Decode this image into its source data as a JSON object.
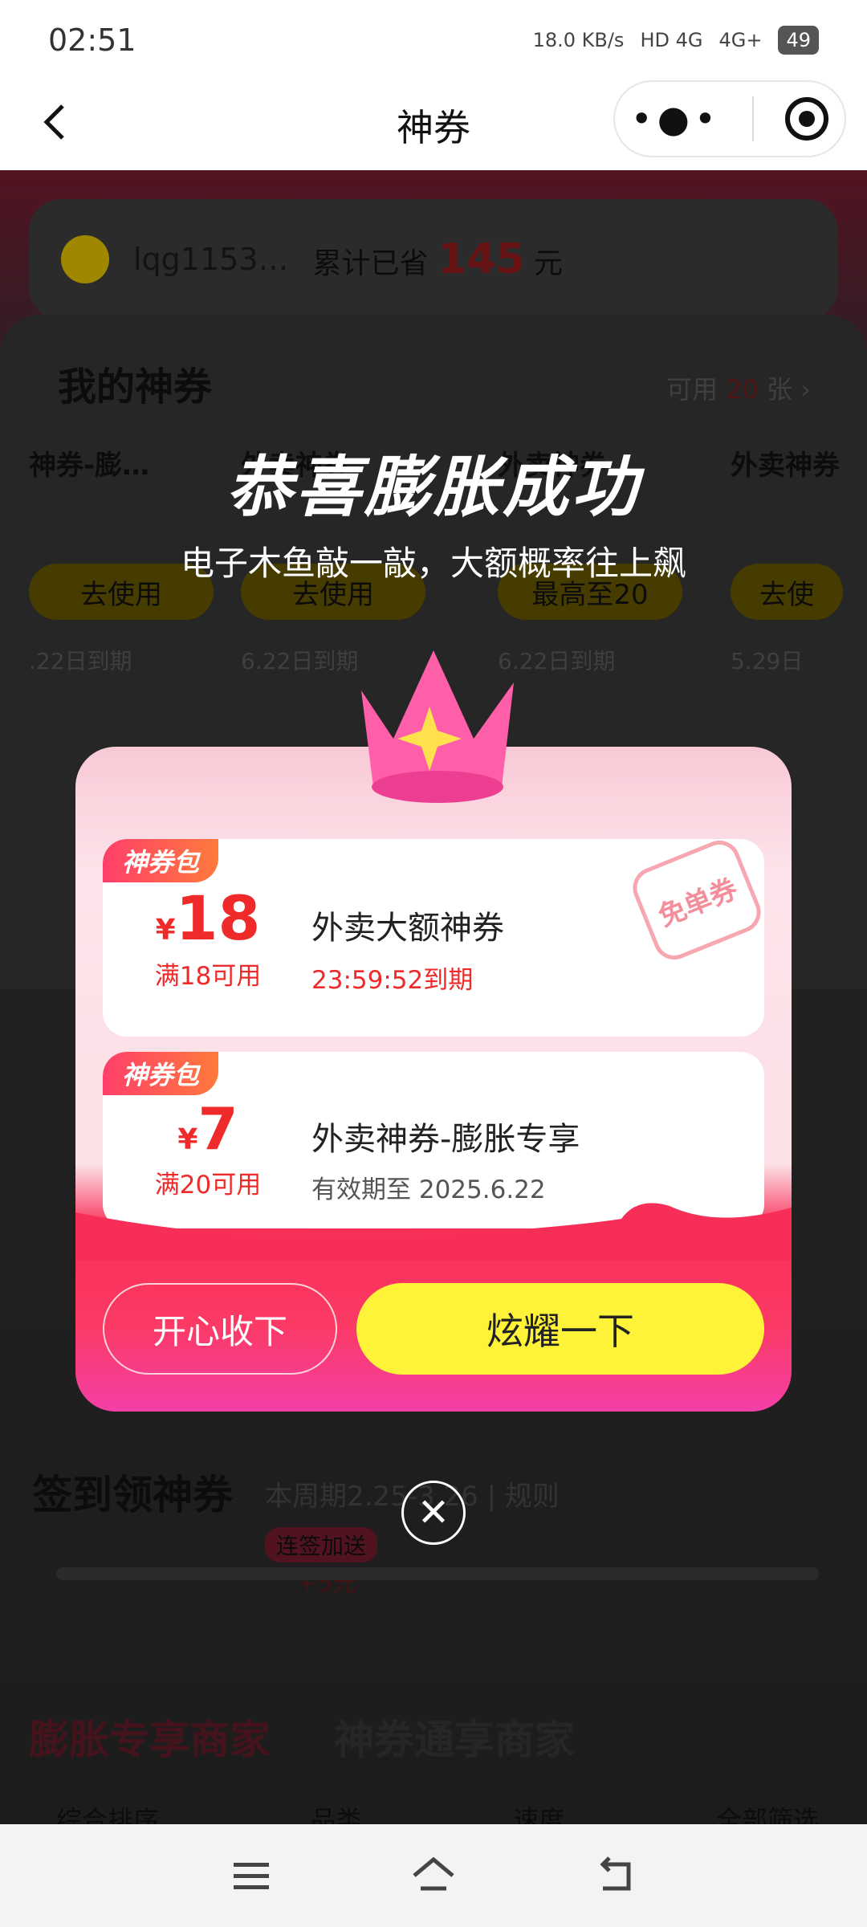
{
  "status_bar": {
    "time": "02:51",
    "net_speed": "18.0 KB/s",
    "signal1": "HD 4G",
    "signal2": "4G+",
    "battery": "49"
  },
  "navbar": {
    "title": "神券",
    "back_icon": "chevron-left-icon",
    "more_icon": "more-dots-icon",
    "target_icon": "target-icon"
  },
  "background": {
    "user": {
      "name": "lqg1153…",
      "saved_label": "累计已省",
      "saved_amount": "145",
      "saved_unit": "元"
    },
    "my_coupons": {
      "title": "我的神券",
      "available_prefix": "可用",
      "available_count": "20",
      "available_suffix": "张"
    },
    "coupons": [
      {
        "title": "神券-膨…",
        "button": "去使用",
        "expire": ".22日到期"
      },
      {
        "title": "外卖神券",
        "button": "去使用",
        "expire": "6.22日到期"
      },
      {
        "title": "外卖神券",
        "button": "最高至20",
        "expire": "6.22日到期"
      },
      {
        "title": "外卖神券",
        "button": "去使",
        "expire": "5.29日"
      }
    ],
    "signin": {
      "title": "签到领神券",
      "subtitle": "本周期2.25-3.26 | 规则",
      "bonus_tag": "连签加送",
      "bonus_amount": "+5元"
    },
    "tabs": [
      "膨胀专享商家",
      "神券通享商家"
    ],
    "filters": [
      "综合排序",
      "品类",
      "速度",
      "全部筛选"
    ]
  },
  "popup": {
    "headline": "恭喜膨胀成功",
    "subline": "电子木鱼敲一敲，大额概率往上飙",
    "coupons": [
      {
        "tag": "神券包",
        "currency": "¥",
        "amount": "18",
        "condition": "满18可用",
        "name": "外卖大额神券",
        "expiry": "23:59:52到期",
        "stamp": "免单券"
      },
      {
        "tag": "神券包",
        "currency": "¥",
        "amount": "7",
        "condition": "满20可用",
        "name": "外卖神券-膨胀专享",
        "expiry": "有效期至 2025.6.22"
      }
    ],
    "btn_keep": "开心收下",
    "btn_show": "炫耀一下",
    "close_icon": "close-icon"
  },
  "bottom_nav": {
    "menu_icon": "menu-icon",
    "home_icon": "home-icon",
    "back_icon": "back-icon"
  },
  "colors": {
    "accent_red": "#ee2a2a",
    "button_yellow": "#fff33a",
    "dialog_pink": "#fb3a65"
  }
}
